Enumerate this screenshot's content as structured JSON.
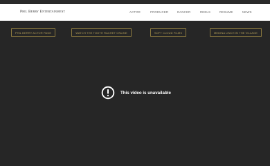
{
  "header": {
    "brand": "Phil Berry Entertainment",
    "nav": [
      {
        "label": "ACTOR"
      },
      {
        "label": "PRODUCER"
      },
      {
        "label": "DANCER"
      },
      {
        "label": "REELS"
      },
      {
        "label": "RESUME"
      },
      {
        "label": "NEWS"
      }
    ]
  },
  "actions": [
    {
      "label": "PHIL BERRY ACTOR PAGE"
    },
    {
      "label": "WATCH THE TOOTH RACHET ONLINE"
    },
    {
      "label": "SOFT CLOUD FILMS"
    },
    {
      "label": "MEDINA LINCH IN THE VILLAGE"
    }
  ],
  "video": {
    "message": "This video is unavailable",
    "icon": "alert-circle-icon"
  },
  "colors": {
    "background": "#262626",
    "header_bg": "#ffffff",
    "accent_gold": "#b39e58",
    "nav_text": "#6a6a6a"
  }
}
